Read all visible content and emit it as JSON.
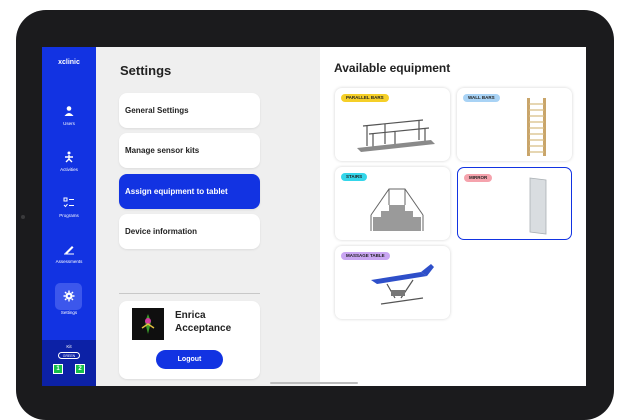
{
  "app": {
    "logo": "xclinic"
  },
  "sidebar": {
    "items": [
      {
        "label": "Users",
        "icon": "user-icon"
      },
      {
        "label": "Activities",
        "icon": "activities-icon"
      },
      {
        "label": "Programs",
        "icon": "programs-icon"
      },
      {
        "label": "Assessments",
        "icon": "assessments-icon"
      },
      {
        "label": "Settings",
        "icon": "gear-icon",
        "active": true
      }
    ],
    "kit": {
      "label": "Kit",
      "badge": "GREEN",
      "slots": [
        "1",
        "2"
      ]
    }
  },
  "settings": {
    "title": "Settings",
    "menu": [
      {
        "label": "General Settings"
      },
      {
        "label": "Manage sensor kits"
      },
      {
        "label": "Assign equipment to tablet",
        "active": true
      },
      {
        "label": "Device information"
      }
    ],
    "user": {
      "name": "Enrica Acceptance",
      "logout_label": "Logout"
    }
  },
  "equipment": {
    "title": "Available equipment",
    "items": [
      {
        "label": "PARALLEL BARS",
        "tag_color": "#f5cf28",
        "selected": false
      },
      {
        "label": "WALL BARS",
        "tag_color": "#a9d3f5",
        "selected": false
      },
      {
        "label": "STAIRS",
        "tag_color": "#34d6ea",
        "selected": false
      },
      {
        "label": "MIRROR",
        "tag_color": "#f5a3ad",
        "selected": true
      },
      {
        "label": "MASSAGE TABLE",
        "tag_color": "#c9a6f2",
        "selected": false
      }
    ]
  },
  "colors": {
    "accent": "#1233e2",
    "kit_green": "#14c04a"
  }
}
